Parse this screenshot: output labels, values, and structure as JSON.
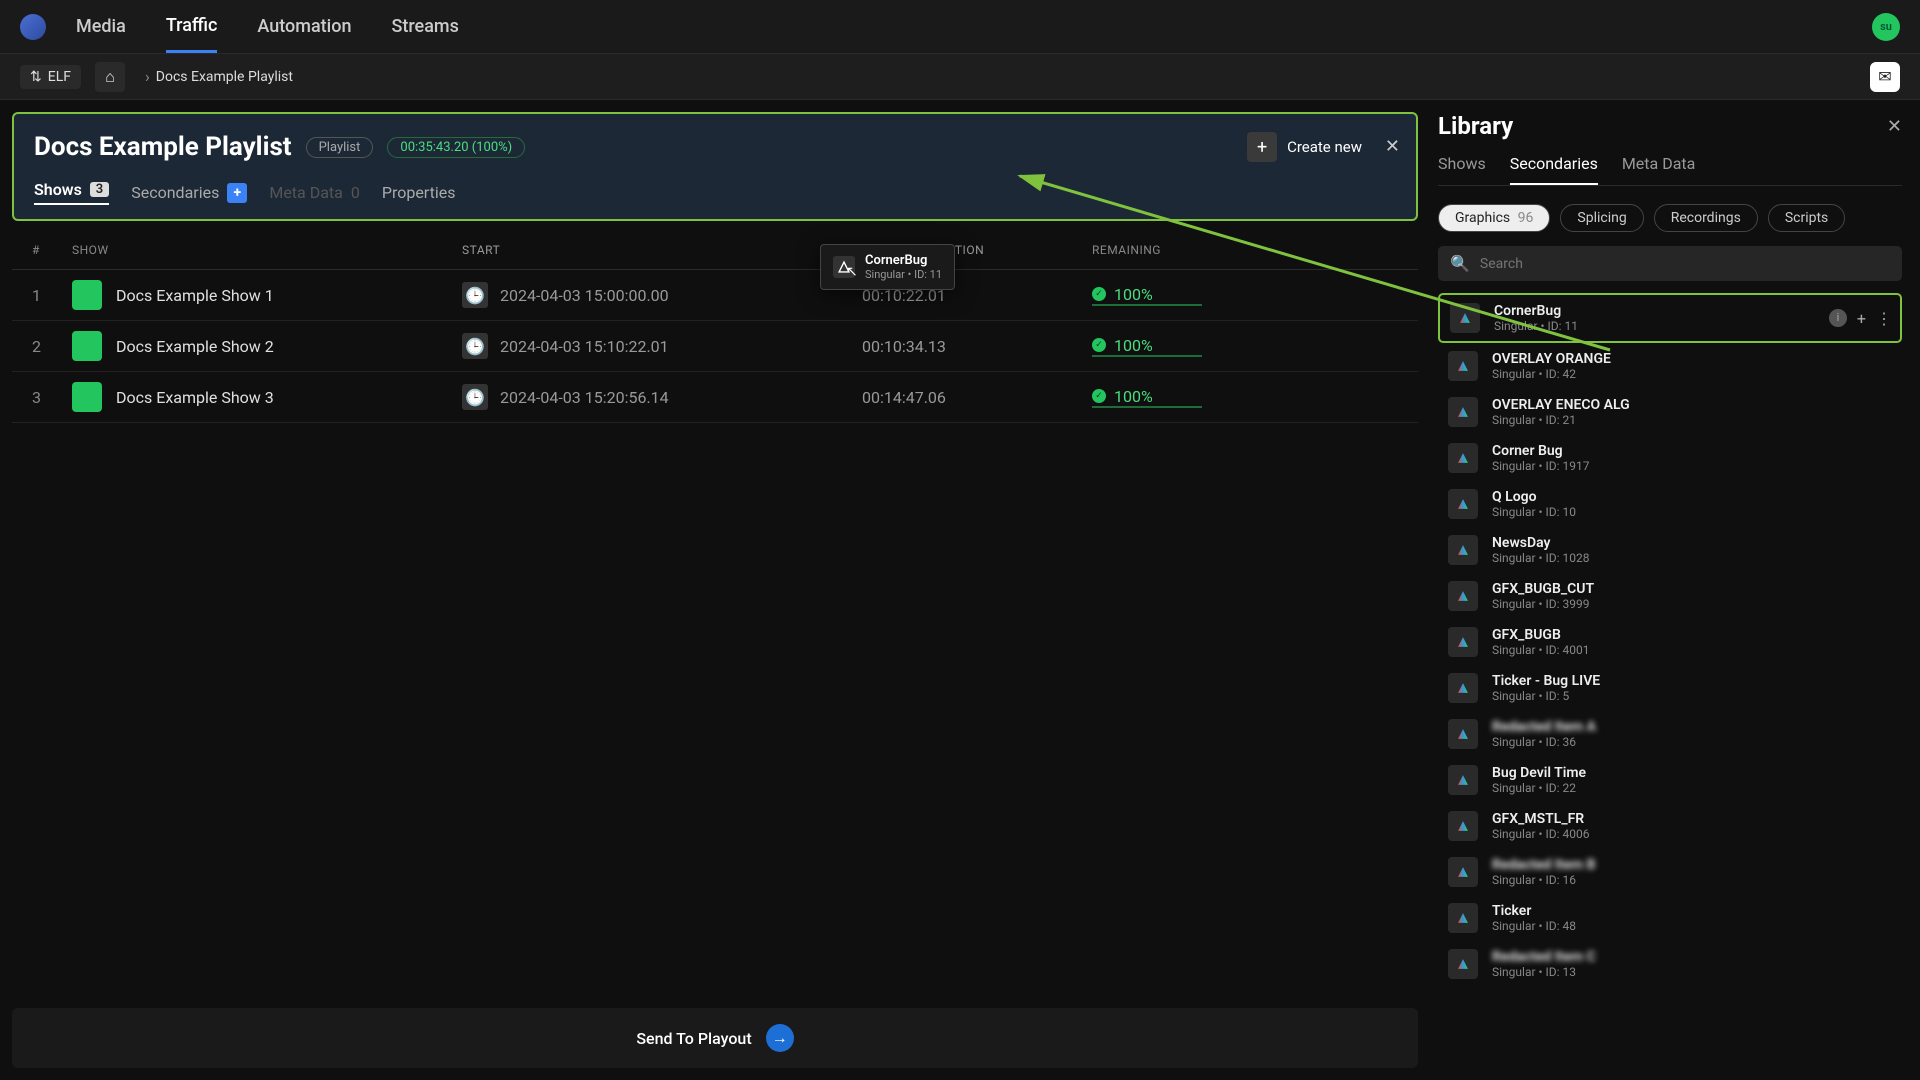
{
  "nav": {
    "media": "Media",
    "traffic": "Traffic",
    "automation": "Automation",
    "streams": "Streams"
  },
  "avatar": "su",
  "channel": "ELF",
  "breadcrumb": "Docs Example Playlist",
  "playlist": {
    "title": "Docs Example Playlist",
    "type_badge": "Playlist",
    "duration_badge": "00:35:43.20 (100%)",
    "create_new": "Create new",
    "tabs": {
      "shows": "Shows",
      "shows_count": "3",
      "secondaries": "Secondaries",
      "metadata": "Meta Data",
      "metadata_count": "0",
      "properties": "Properties"
    },
    "table_headers": {
      "num": "#",
      "show": "SHOW",
      "start": "START",
      "planned": "PLANNED DURATION",
      "remaining": "REMAINING"
    },
    "rows": [
      {
        "num": "1",
        "show": "Docs Example Show 1",
        "start": "2024-04-03 15:00:00.00",
        "dur": "00:10:22.01",
        "rem": "100%"
      },
      {
        "num": "2",
        "show": "Docs Example Show 2",
        "start": "2024-04-03 15:10:22.01",
        "dur": "00:10:34.13",
        "rem": "100%"
      },
      {
        "num": "3",
        "show": "Docs Example Show 3",
        "start": "2024-04-03 15:20:56.14",
        "dur": "00:14:47.06",
        "rem": "100%"
      }
    ]
  },
  "drag_ghost": {
    "name": "CornerBug",
    "sub": "Singular • ID: 11"
  },
  "send_to_playout": "Send To Playout",
  "library": {
    "title": "Library",
    "tabs": {
      "shows": "Shows",
      "secondaries": "Secondaries",
      "metadata": "Meta Data"
    },
    "filters": {
      "graphics": "Graphics",
      "graphics_count": "96",
      "splicing": "Splicing",
      "recordings": "Recordings",
      "scripts": "Scripts"
    },
    "search_placeholder": "Search",
    "items": [
      {
        "name": "CornerBug",
        "sub": "Singular • ID: 11",
        "highlight": true,
        "actions": true
      },
      {
        "name": "OVERLAY ORANGE",
        "sub": "Singular • ID: 42"
      },
      {
        "name": "OVERLAY ENECO ALG",
        "sub": "Singular • ID: 21"
      },
      {
        "name": "Corner Bug",
        "sub": "Singular • ID: 1917"
      },
      {
        "name": "Q Logo",
        "sub": "Singular • ID: 10"
      },
      {
        "name": "NewsDay",
        "sub": "Singular • ID: 1028"
      },
      {
        "name": "GFX_BUGB_CUT",
        "sub": "Singular • ID: 3999"
      },
      {
        "name": "GFX_BUGB",
        "sub": "Singular • ID: 4001"
      },
      {
        "name": "Ticker - Bug LIVE",
        "sub": "Singular • ID: 5"
      },
      {
        "name": "Redacted Item A",
        "sub": "Singular • ID: 36",
        "blur": true
      },
      {
        "name": "Bug Devil Time",
        "sub": "Singular • ID: 22"
      },
      {
        "name": "GFX_MSTL_FR",
        "sub": "Singular • ID: 4006"
      },
      {
        "name": "Redacted Item B",
        "sub": "Singular • ID: 16",
        "blur": true
      },
      {
        "name": "Ticker",
        "sub": "Singular • ID: 48"
      },
      {
        "name": "Redacted Item C",
        "sub": "Singular • ID: 13",
        "blur": true
      }
    ]
  }
}
